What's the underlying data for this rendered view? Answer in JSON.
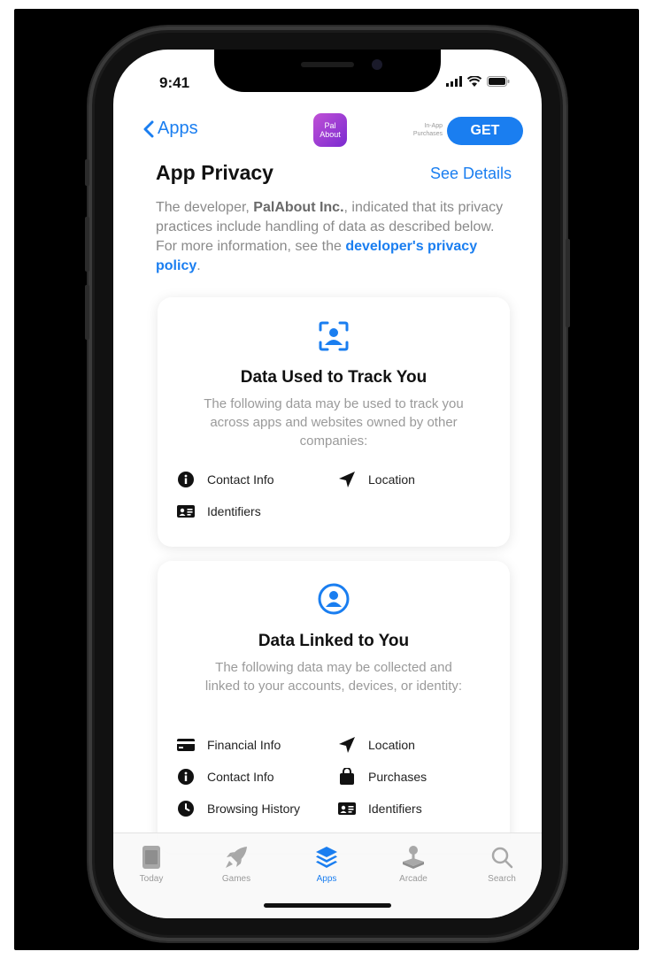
{
  "status_bar": {
    "time": "9:41"
  },
  "nav": {
    "back_label": "Apps",
    "app_icon_text_line1": "Pal",
    "app_icon_text_line2": "About",
    "iap_line1": "In-App",
    "iap_line2": "Purchases",
    "get_label": "GET"
  },
  "privacy": {
    "title": "App Privacy",
    "see_details": "See Details",
    "desc_part1": "The developer, ",
    "developer": "PalAbout Inc.",
    "desc_part2": ", indicated that its privacy practices include handling of data as described below. For more information, see the ",
    "policy_link": "developer's privacy policy",
    "desc_part3": "."
  },
  "track_card": {
    "title": "Data Used to Track You",
    "subtitle": "The following data may be used to track you across apps and websites owned by other companies:",
    "items": [
      {
        "label": "Contact Info",
        "icon": "info-icon"
      },
      {
        "label": "Location",
        "icon": "location-arrow-icon"
      },
      {
        "label": "Identifiers",
        "icon": "id-card-icon"
      }
    ]
  },
  "linked_card": {
    "title": "Data Linked to You",
    "subtitle": "The following data may be collected and linked to your accounts, devices, or identity:",
    "items": [
      {
        "label": "Financial Info",
        "icon": "credit-card-icon"
      },
      {
        "label": "Location",
        "icon": "location-arrow-icon"
      },
      {
        "label": "Contact Info",
        "icon": "info-icon"
      },
      {
        "label": "Purchases",
        "icon": "shopping-bag-icon"
      },
      {
        "label": "Browsing History",
        "icon": "clock-icon"
      },
      {
        "label": "Identifiers",
        "icon": "id-card-icon"
      }
    ]
  },
  "tabs": [
    {
      "label": "Today"
    },
    {
      "label": "Games"
    },
    {
      "label": "Apps"
    },
    {
      "label": "Arcade"
    },
    {
      "label": "Search"
    }
  ],
  "colors": {
    "accent": "#1a7ef0",
    "text": "#111111",
    "muted": "#8a8a8a"
  }
}
